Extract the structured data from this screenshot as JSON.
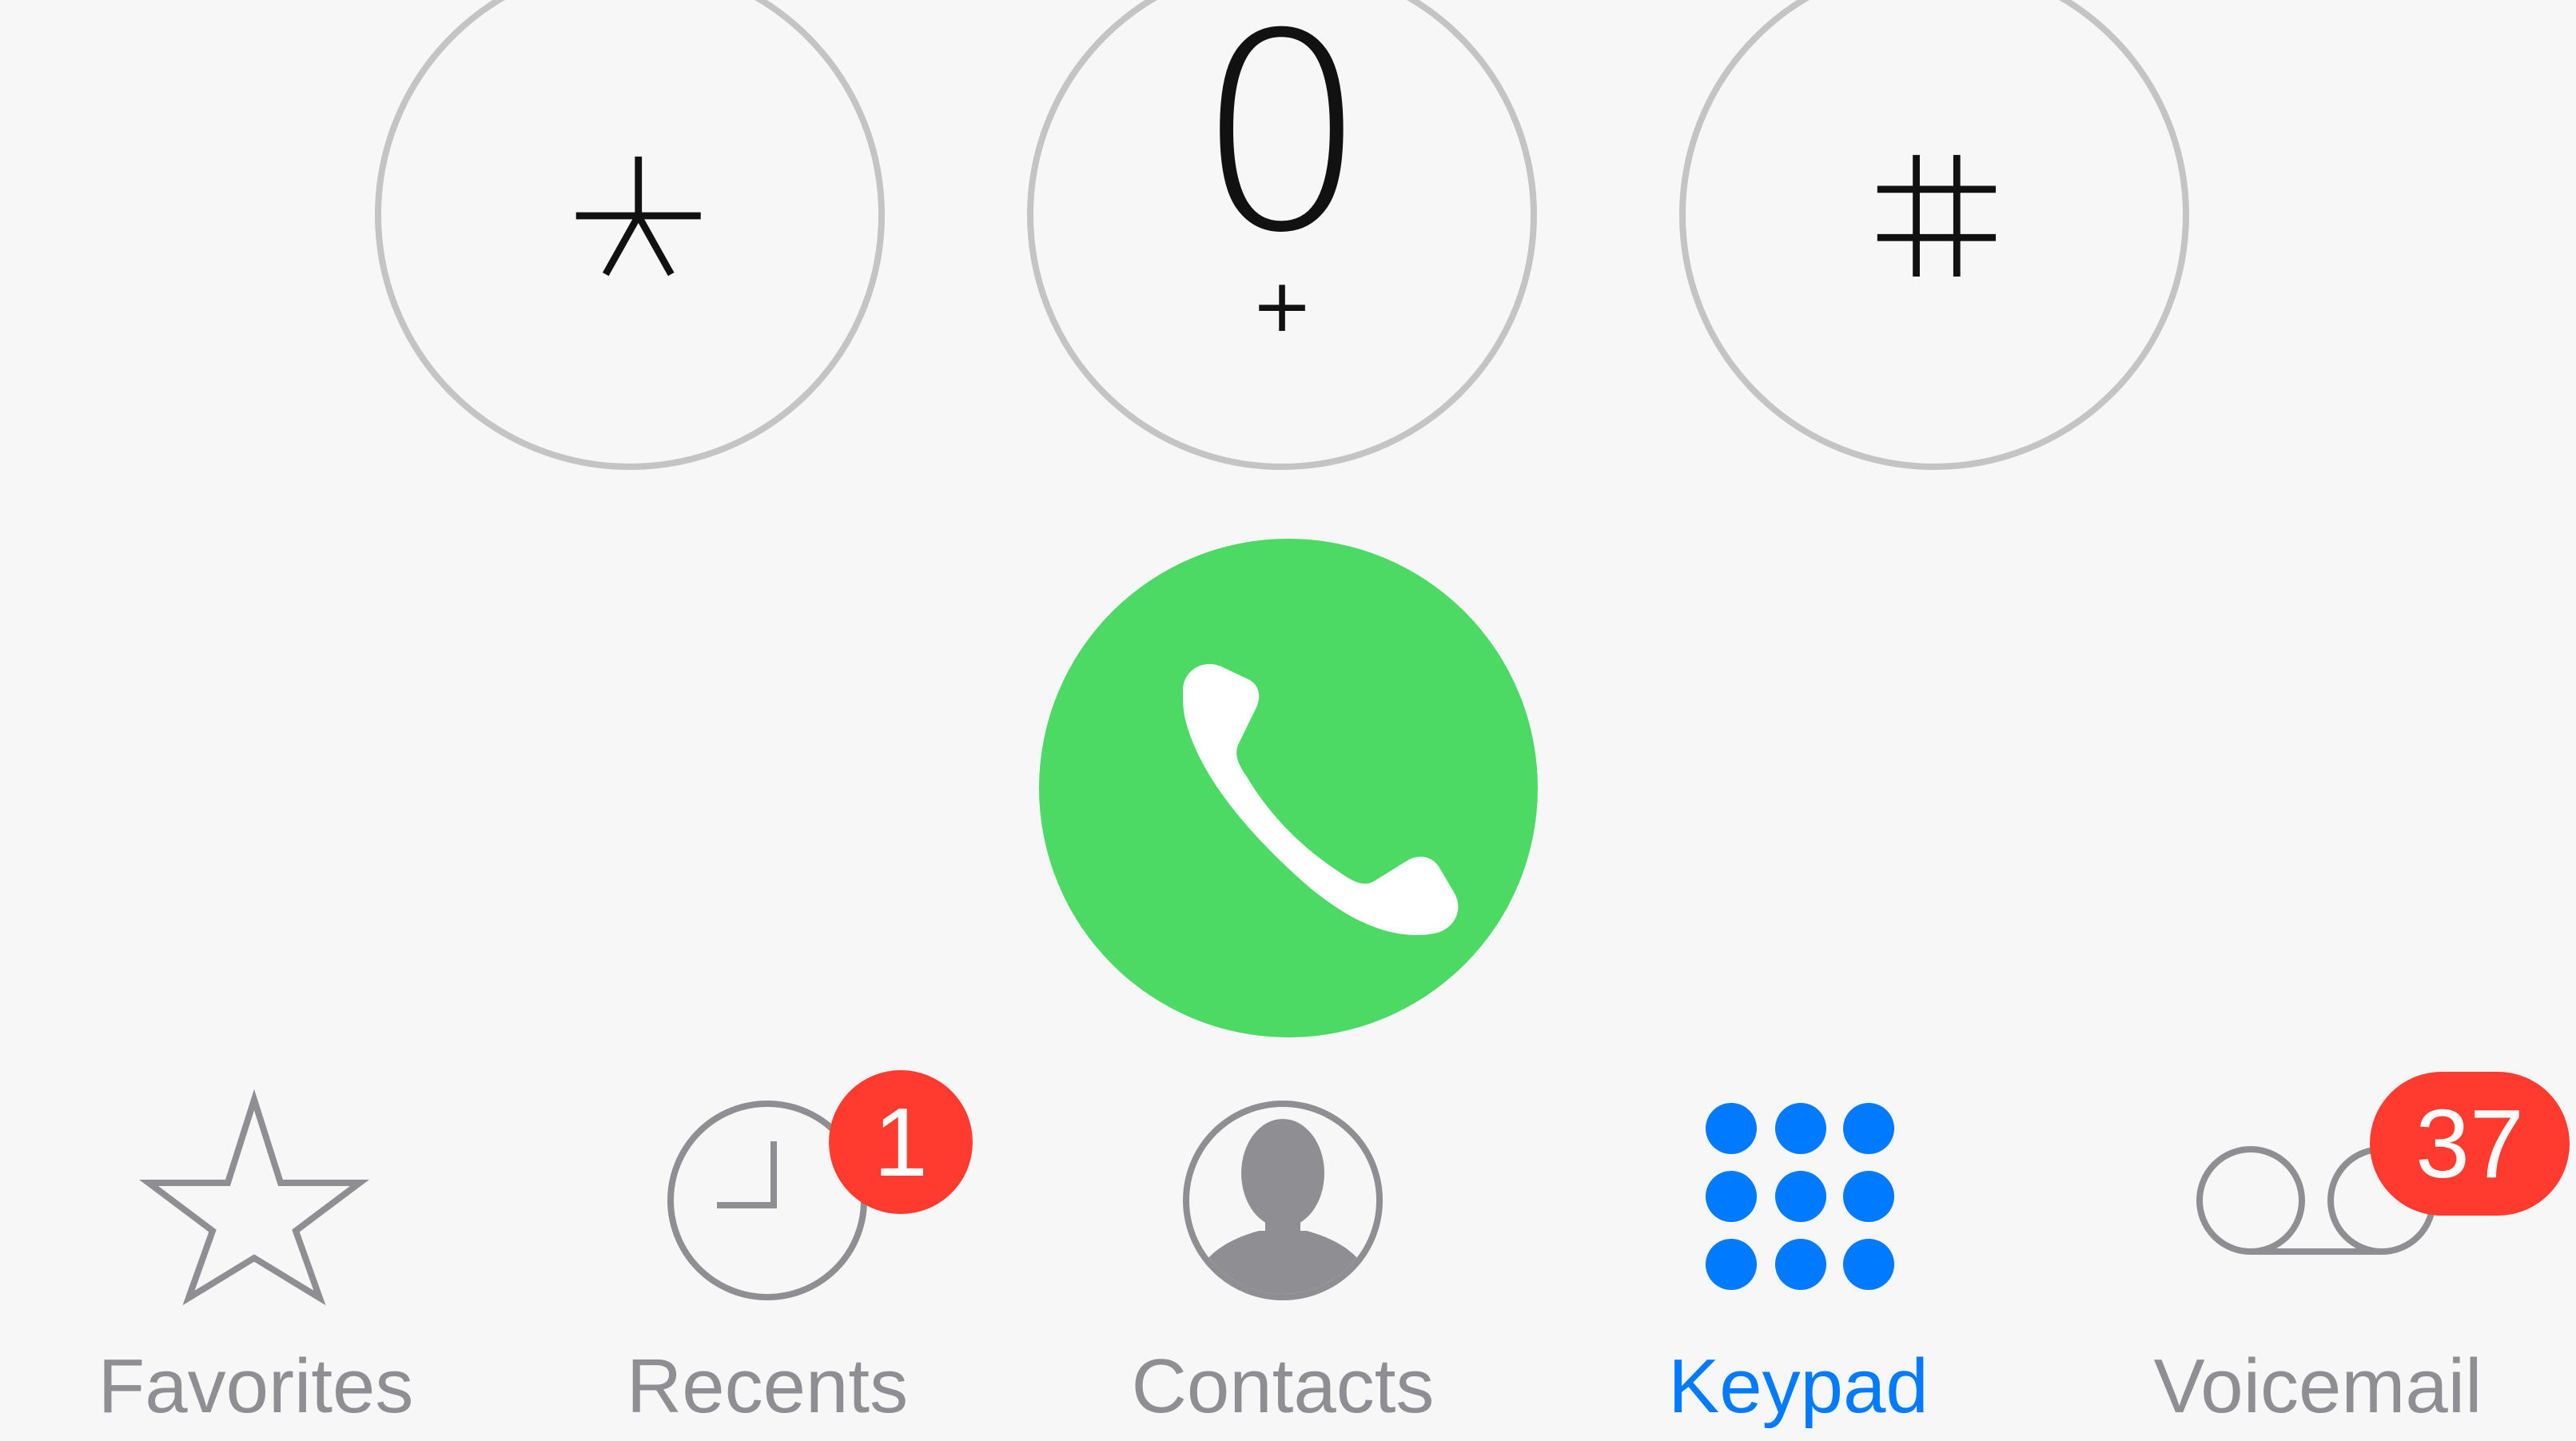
{
  "keypad": {
    "keys": [
      {
        "id": "star",
        "symbol": "*",
        "sub": ""
      },
      {
        "id": "zero",
        "symbol": "0",
        "sub": "+"
      },
      {
        "id": "hash",
        "symbol": "#",
        "sub": ""
      }
    ],
    "call_icon": "phone-icon"
  },
  "colors": {
    "call_green": "#4cd964",
    "active_blue": "#007aff",
    "inactive_gray": "#8e8e93",
    "badge_red": "#ff3b30",
    "key_border": "#c4c4c4",
    "background": "#f7f7f7"
  },
  "tab_bar": {
    "active": "keypad",
    "tabs": [
      {
        "id": "favorites",
        "label": "Favorites",
        "icon": "star-icon",
        "badge": ""
      },
      {
        "id": "recents",
        "label": "Recents",
        "icon": "clock-icon",
        "badge": "1"
      },
      {
        "id": "contacts",
        "label": "Contacts",
        "icon": "person-icon",
        "badge": ""
      },
      {
        "id": "keypad",
        "label": "Keypad",
        "icon": "keypad-icon",
        "badge": ""
      },
      {
        "id": "voicemail",
        "label": "Voicemail",
        "icon": "voicemail-icon",
        "badge": "37"
      }
    ]
  }
}
